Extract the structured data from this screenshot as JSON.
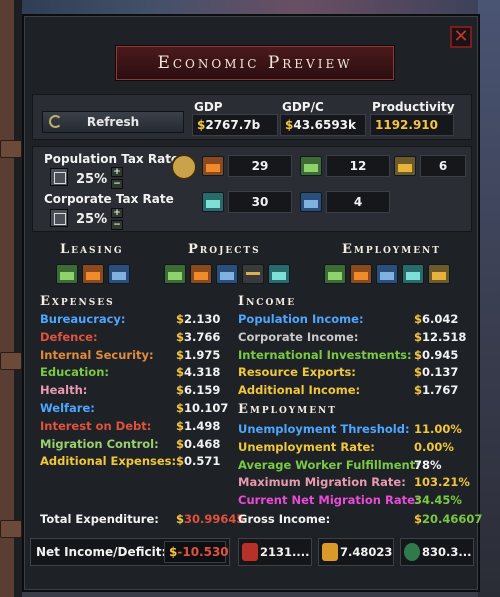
{
  "window": {
    "title": "Economic Preview",
    "close_symbol": "✕"
  },
  "summary": {
    "refresh_label": "Refresh",
    "gdp_label": "GDP",
    "gdp_value": "$2767.7b",
    "gdpc_label": "GDP/C",
    "gdpc_value": "$43.6593k",
    "productivity_label": "Productivity",
    "productivity_value": "1192.910"
  },
  "taxes": {
    "population_label": "Population Tax Rate",
    "population_value": "25%",
    "corporate_label": "Corporate Tax Rate",
    "corporate_value": "25%",
    "counts": [
      "29",
      "12",
      "6",
      "30",
      "4"
    ]
  },
  "categories": {
    "leasing": "Leasing",
    "projects": "Projects",
    "employment": "Employment"
  },
  "expenses": {
    "header": "Expenses",
    "items": [
      {
        "label": "Bureaucracy:",
        "value": "2.130",
        "color": "#4da6ff"
      },
      {
        "label": "Defence:",
        "value": "3.766",
        "color": "#e0523d"
      },
      {
        "label": "Internal Security:",
        "value": "1.975",
        "color": "#e08a3d"
      },
      {
        "label": "Education:",
        "value": "4.318",
        "color": "#7ac943"
      },
      {
        "label": "Health:",
        "value": "6.159",
        "color": "#e89bb0"
      },
      {
        "label": "Welfare:",
        "value": "10.107",
        "color": "#4da6ff"
      },
      {
        "label": "Interest on Debt:",
        "value": "1.498",
        "color": "#e0523d"
      },
      {
        "label": "Migration Control:",
        "value": "0.468",
        "color": "#9ccf6e"
      },
      {
        "label": "Additional Expenses:",
        "value": "0.571",
        "color": "#f0c73a"
      }
    ],
    "total_label": "Total Expenditure:",
    "total_value": "30.99645"
  },
  "income": {
    "header": "Income",
    "items": [
      {
        "label": "Population Income:",
        "value": "6.042",
        "color": "#4da6ff"
      },
      {
        "label": "Corporate Income:",
        "value": "12.518",
        "color": "#c9c9c9"
      },
      {
        "label": "International Investments:",
        "value": "0.945",
        "color": "#7ac943"
      },
      {
        "label": "Resource Exports:",
        "value": "0.137",
        "color": "#f0c73a"
      },
      {
        "label": "Additional Income:",
        "value": "1.767",
        "color": "#f0c73a"
      }
    ],
    "gross_label": "Gross Income:",
    "gross_value": "20.46607"
  },
  "employment": {
    "header": "Employment",
    "items": [
      {
        "label": "Unemployment Threshold:",
        "value": "11.00%",
        "color": "#4da6ff",
        "value_color": "#f0c73a"
      },
      {
        "label": "Unemployment Rate:",
        "value": "0.00%",
        "color": "#f0c73a",
        "value_color": "#f0c73a"
      },
      {
        "label": "Average Worker Fulfillment:",
        "value": "78%",
        "color": "#7ac943",
        "value_color": "#f2f2f2"
      },
      {
        "label": "Maximum Migration Rate:",
        "value": "103.21%",
        "color": "#e89bb0",
        "value_color": "#f0c73a"
      },
      {
        "label": "Current Net Migration Rate:",
        "value": "34.45%",
        "color": "#e84bd8",
        "value_color": "#7ac943"
      }
    ]
  },
  "footer": {
    "net_label": "Net Income/Deficit:",
    "net_dollar": "$",
    "net_value": "-10.530",
    "debt_value": "2131....",
    "interest_value": "7.48023",
    "reserves_value": "830.3..."
  }
}
